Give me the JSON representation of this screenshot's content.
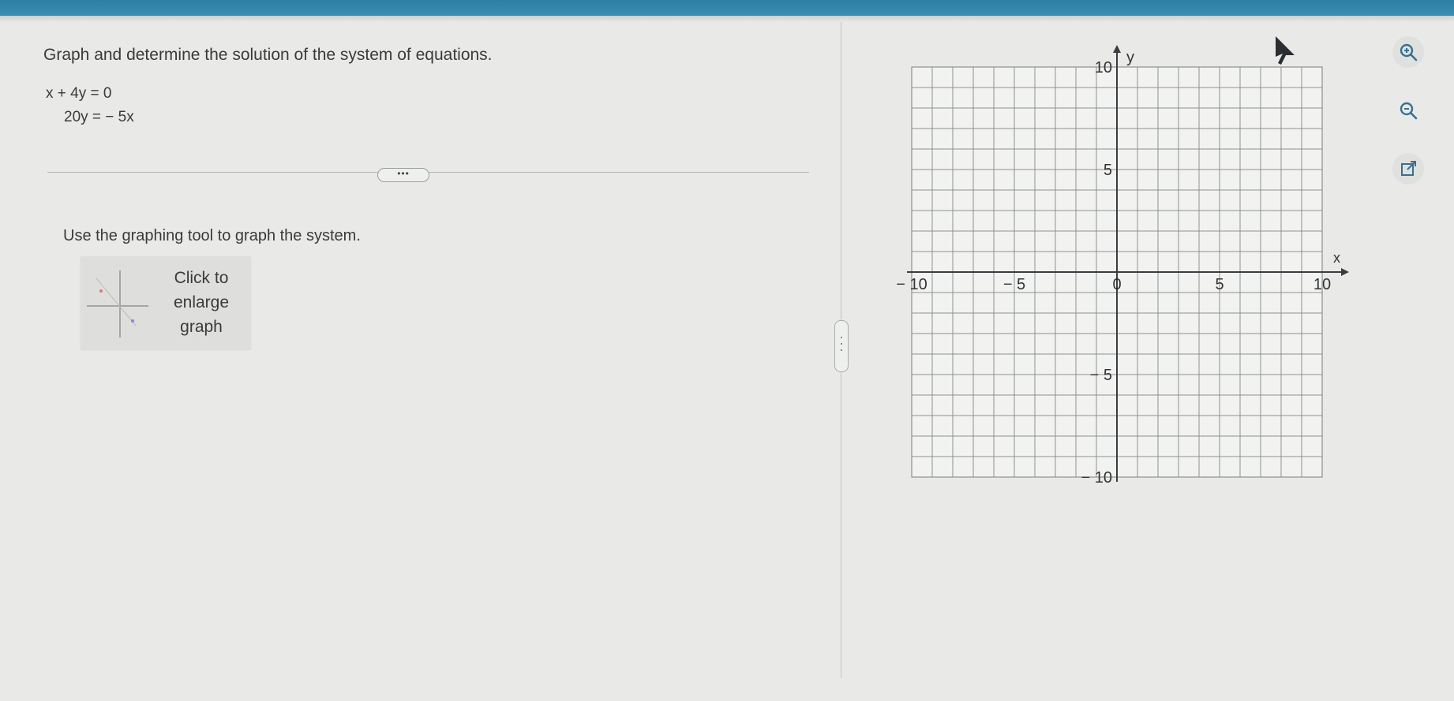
{
  "question": {
    "prompt": "Graph and determine the solution of the system of equations.",
    "equation_1": "x + 4y = 0",
    "equation_2": "20y = − 5x",
    "more_label": "•••",
    "instruction": "Use the graphing tool to graph the system."
  },
  "enlarge_graph": {
    "line1": "Click to",
    "line2": "enlarge",
    "line3": "graph"
  },
  "graph": {
    "x_axis_label": "x",
    "y_axis_label": "y",
    "x_min": -10,
    "x_max": 10,
    "y_min": -10,
    "y_max": 10,
    "grid_step": 1,
    "x_ticks": [
      {
        "value": -10,
        "label": "− 10"
      },
      {
        "value": -5,
        "label": "− 5"
      },
      {
        "value": 0,
        "label": "0"
      },
      {
        "value": 5,
        "label": "5"
      },
      {
        "value": 10,
        "label": "10"
      }
    ],
    "y_ticks": [
      {
        "value": 10,
        "label": "10"
      },
      {
        "value": 5,
        "label": "5"
      },
      {
        "value": -5,
        "label": "− 5"
      },
      {
        "value": -10,
        "label": "− 10"
      }
    ]
  },
  "tools": {
    "zoom_in_icon": "zoom-in-icon",
    "zoom_out_icon": "zoom-out-icon",
    "popout_icon": "popout-icon"
  },
  "colors": {
    "header": "#2f7fa4",
    "grid": "#8c9092",
    "axis": "#3a3d40",
    "accent_icon": "#3a6f8f"
  }
}
